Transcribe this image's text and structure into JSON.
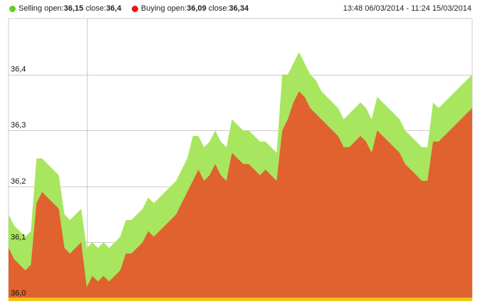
{
  "legend": {
    "sell_label": "Selling open:",
    "sell_open": "36,15",
    "sell_close_label": " close:",
    "sell_close": "36,4",
    "buy_label": "Buying open:",
    "buy_open": "36,09",
    "buy_close_label": " close:",
    "buy_close": "36,34"
  },
  "range_text": "13:48 06/03/2014 - 11:24 15/03/2014",
  "colors": {
    "selling": "#a8e65f",
    "buying": "#e0622e",
    "baseline": "#f2c318",
    "grid": "#cccccc",
    "sell_dot": "#66cc22",
    "buy_dot": "#ee1111"
  },
  "chart_data": {
    "type": "area",
    "ylim": [
      36.0,
      36.5
    ],
    "yticks": [
      {
        "value": 36.0,
        "label": "36,0"
      },
      {
        "value": 36.1,
        "label": "36,1"
      },
      {
        "value": 36.2,
        "label": "36,2"
      },
      {
        "value": 36.3,
        "label": "36,3"
      },
      {
        "value": 36.4,
        "label": "36,4"
      }
    ],
    "grid": "horizontal",
    "series": [
      {
        "name": "Selling",
        "values": [
          36.15,
          36.13,
          36.12,
          36.11,
          36.12,
          36.25,
          36.25,
          36.24,
          36.23,
          36.22,
          36.15,
          36.14,
          36.15,
          36.16,
          36.09,
          36.1,
          36.09,
          36.1,
          36.09,
          36.1,
          36.11,
          36.14,
          36.14,
          36.15,
          36.16,
          36.18,
          36.17,
          36.18,
          36.19,
          36.2,
          36.21,
          36.23,
          36.25,
          36.29,
          36.29,
          36.27,
          36.28,
          36.3,
          36.28,
          36.27,
          36.32,
          36.31,
          36.3,
          36.3,
          36.29,
          36.28,
          36.28,
          36.27,
          36.26,
          36.4,
          36.4,
          36.42,
          36.44,
          36.42,
          36.4,
          36.39,
          36.37,
          36.36,
          36.35,
          36.34,
          36.32,
          36.33,
          36.34,
          36.35,
          36.34,
          36.32,
          36.36,
          36.35,
          36.34,
          36.33,
          36.32,
          36.3,
          36.29,
          36.28,
          36.27,
          36.27,
          36.35,
          36.34,
          36.35,
          36.36,
          36.37,
          36.38,
          36.39,
          36.4
        ]
      },
      {
        "name": "Buying",
        "values": [
          36.09,
          36.07,
          36.06,
          36.05,
          36.06,
          36.17,
          36.19,
          36.18,
          36.17,
          36.16,
          36.09,
          36.08,
          36.09,
          36.1,
          36.02,
          36.04,
          36.03,
          36.04,
          36.03,
          36.04,
          36.05,
          36.08,
          36.08,
          36.09,
          36.1,
          36.12,
          36.11,
          36.12,
          36.13,
          36.14,
          36.15,
          36.17,
          36.19,
          36.21,
          36.23,
          36.21,
          36.22,
          36.24,
          36.22,
          36.21,
          36.26,
          36.25,
          36.24,
          36.24,
          36.23,
          36.22,
          36.23,
          36.22,
          36.21,
          36.3,
          36.32,
          36.35,
          36.37,
          36.36,
          36.34,
          36.33,
          36.32,
          36.31,
          36.3,
          36.29,
          36.27,
          36.27,
          36.28,
          36.29,
          36.28,
          36.26,
          36.3,
          36.29,
          36.28,
          36.27,
          36.26,
          36.24,
          36.23,
          36.22,
          36.21,
          36.21,
          36.28,
          36.28,
          36.29,
          36.3,
          36.31,
          36.32,
          36.33,
          36.34
        ]
      }
    ]
  }
}
